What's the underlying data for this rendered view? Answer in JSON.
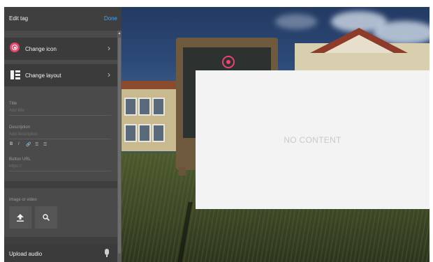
{
  "panel": {
    "title": "Edit tag",
    "done_label": "Done",
    "change_icon_label": "Change icon",
    "change_layout_label": "Change layout",
    "title_label": "Title",
    "title_placeholder": "Add title",
    "description_label": "Description",
    "description_placeholder": "Add description",
    "format_buttons": [
      "B",
      "I",
      "🔗",
      "☰",
      "☰"
    ],
    "button_url_label": "Button URL",
    "button_url_placeholder": "https://",
    "media_label": "Image or video",
    "upload_audio_label": "Upload audio"
  },
  "content": {
    "empty_label": "NO CONTENT"
  },
  "icons": {
    "tag_icon": "target-icon",
    "layout_icon": "layout-icon",
    "upload_icon": "upload-icon",
    "search_icon": "search-icon",
    "mic_icon": "microphone-icon"
  },
  "colors": {
    "accent": "#3da5ff",
    "tag_icon": "#e7456b",
    "panel_bg": "#4a4a4a",
    "content_bg": "#f3f3f3"
  }
}
